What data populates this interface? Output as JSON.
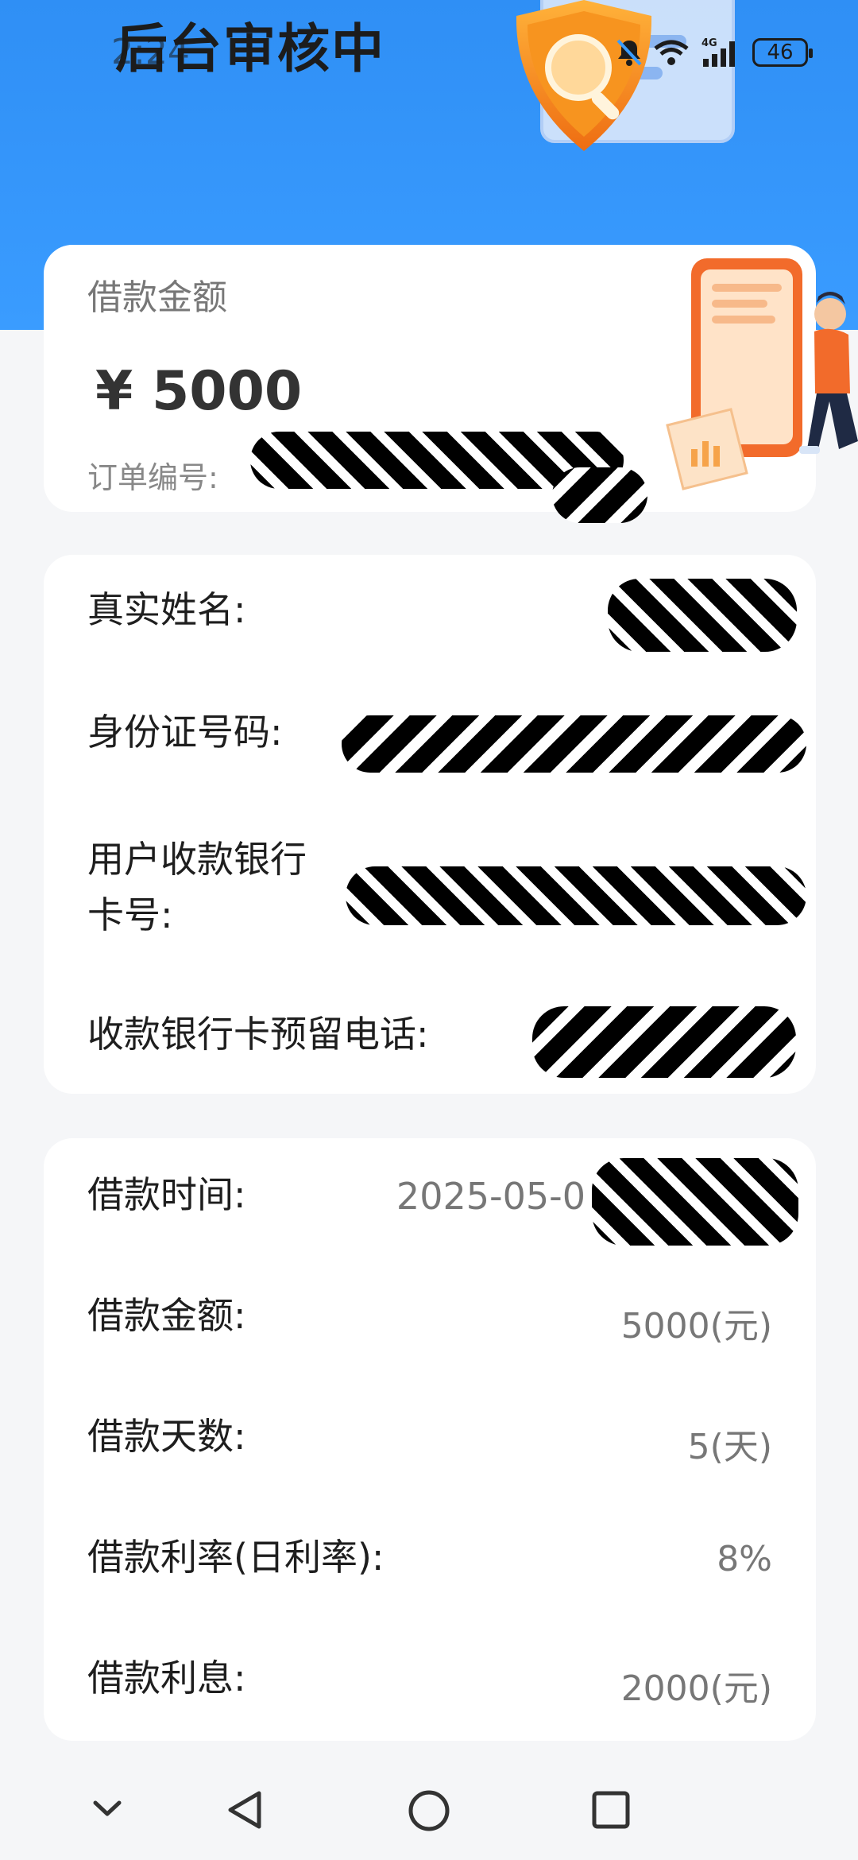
{
  "status_bar": {
    "time": "2:24",
    "battery": "46"
  },
  "header": {
    "title": "后台审核中"
  },
  "summary": {
    "amount_label": "借款金额",
    "amount_value": "¥ 5000",
    "order_label": "订单编号:"
  },
  "identity": {
    "name_label": "真实姓名:",
    "id_label": "身份证号码:",
    "card_label_line1": "用户收款银行",
    "card_label_line2": "卡号:",
    "phone_label": "收款银行卡预留电话:"
  },
  "loan": {
    "time_label": "借款时间:",
    "time_value": "2025-05-0",
    "amount_label": "借款金额:",
    "amount_value": "5000(元)",
    "days_label": "借款天数:",
    "days_value": "5(天)",
    "rate_label": "借款利率(日利率):",
    "rate_value": "8%",
    "interest_label": "借款利息:",
    "interest_value": "2000(元)"
  },
  "nav": {
    "icons": [
      "chevron-down-icon",
      "back-icon",
      "home-icon",
      "recents-icon"
    ]
  },
  "colors": {
    "header_blue": "#3a9cff",
    "shield_orange": "#f08a1c"
  }
}
